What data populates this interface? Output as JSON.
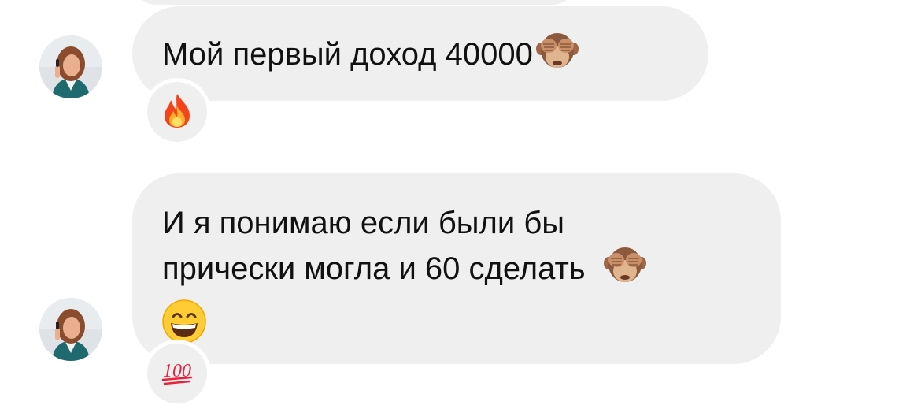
{
  "messages": [
    {
      "text": "Мой первый доход 40000",
      "inline_emoji": "see-no-evil-monkey-icon",
      "reaction": "fire-icon"
    },
    {
      "text_line1": "И я понимаю если были бы",
      "text_line2": "прически могла и 60 сделать",
      "inline_emojis": [
        "see-no-evil-monkey-icon",
        "grinning-face-icon"
      ],
      "reaction": "hundred-points-icon"
    }
  ],
  "colors": {
    "bubble": "#efefef",
    "text": "#111111",
    "background": "#ffffff",
    "hundred_red": "#e5243b"
  }
}
